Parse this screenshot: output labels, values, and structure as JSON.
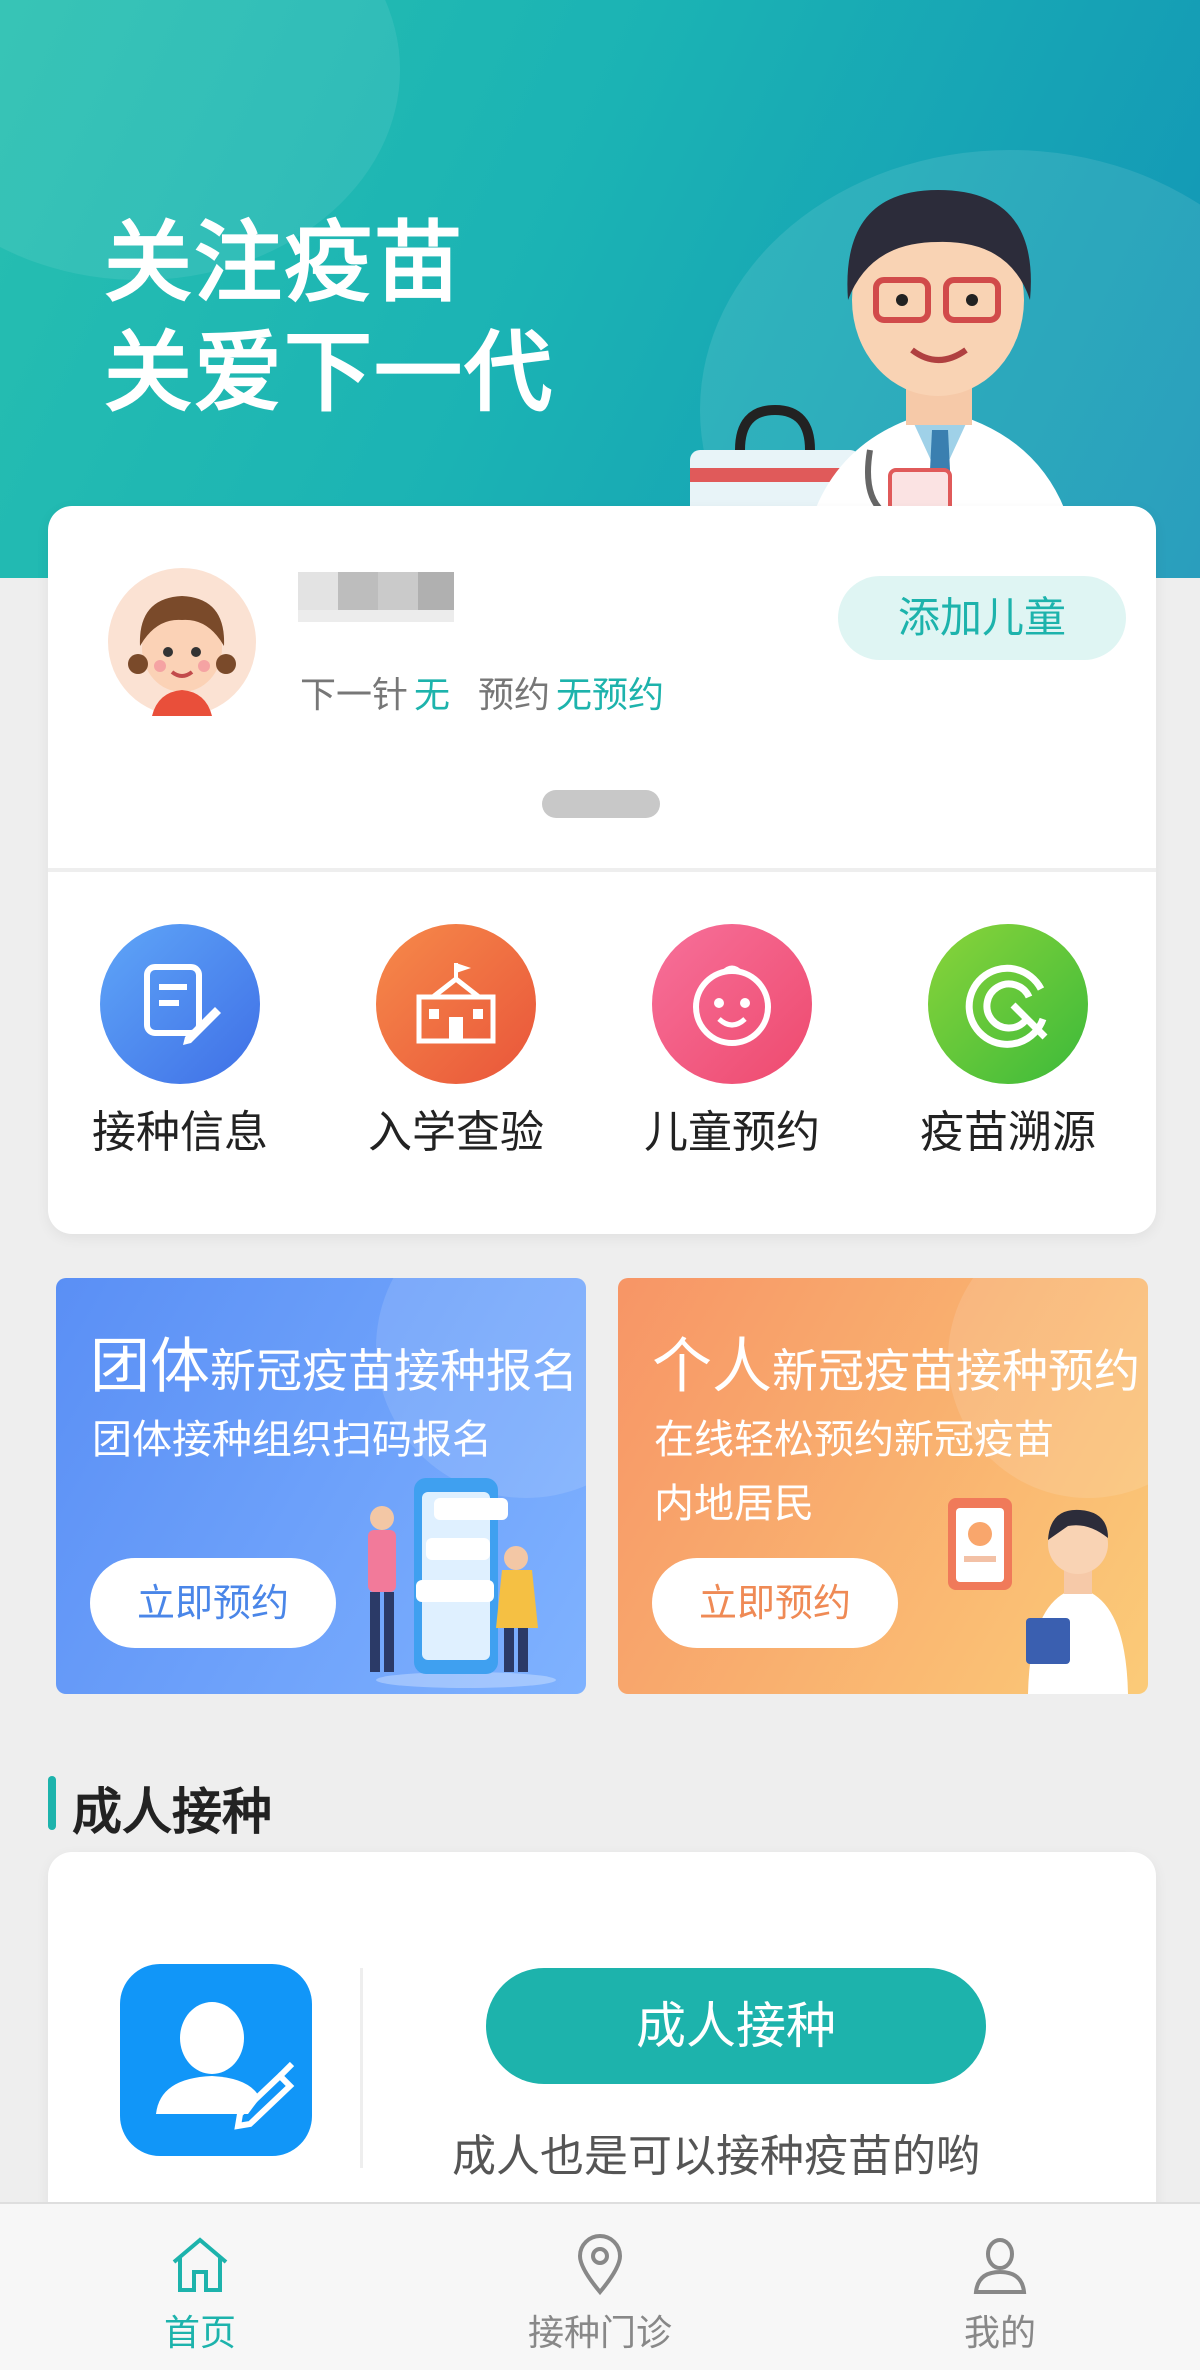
{
  "hero": {
    "line1": "关注疫苗",
    "line2": "关爱下一代"
  },
  "child": {
    "next_dose_label": "下一针",
    "next_dose_value": "无",
    "appointment_label": "预约",
    "appointment_value": "无预约",
    "add_button": "添加儿童"
  },
  "quick_actions": [
    {
      "label": "接种信息",
      "icon": "document-edit-icon",
      "color": "#4a86f0"
    },
    {
      "label": "入学查验",
      "icon": "school-icon",
      "color": "#f0643e"
    },
    {
      "label": "儿童预约",
      "icon": "baby-face-icon",
      "color": "#f2547e"
    },
    {
      "label": "疫苗溯源",
      "icon": "trace-icon",
      "color": "#5bc93a"
    }
  ],
  "banners": [
    {
      "title_big": "团体",
      "title_rest": "新冠疫苗接种报名",
      "sub1": "团体接种组织扫码报名",
      "sub2": "",
      "button": "立即预约"
    },
    {
      "title_big": "个人",
      "title_rest": "新冠疫苗接种预约",
      "sub1": "在线轻松预约新冠疫苗",
      "sub2": "内地居民",
      "button": "立即预约"
    }
  ],
  "adult": {
    "section_title": "成人接种",
    "button": "成人接种",
    "description": "成人也是可以接种疫苗的哟"
  },
  "tabbar": [
    {
      "label": "首页",
      "icon": "home-icon",
      "active": true
    },
    {
      "label": "接种门诊",
      "icon": "location-pin-icon",
      "active": false
    },
    {
      "label": "我的",
      "icon": "user-icon",
      "active": false
    }
  ],
  "colors": {
    "accent": "#1db3ac",
    "hero_start": "#27bfb0",
    "hero_end": "#1294b6"
  }
}
